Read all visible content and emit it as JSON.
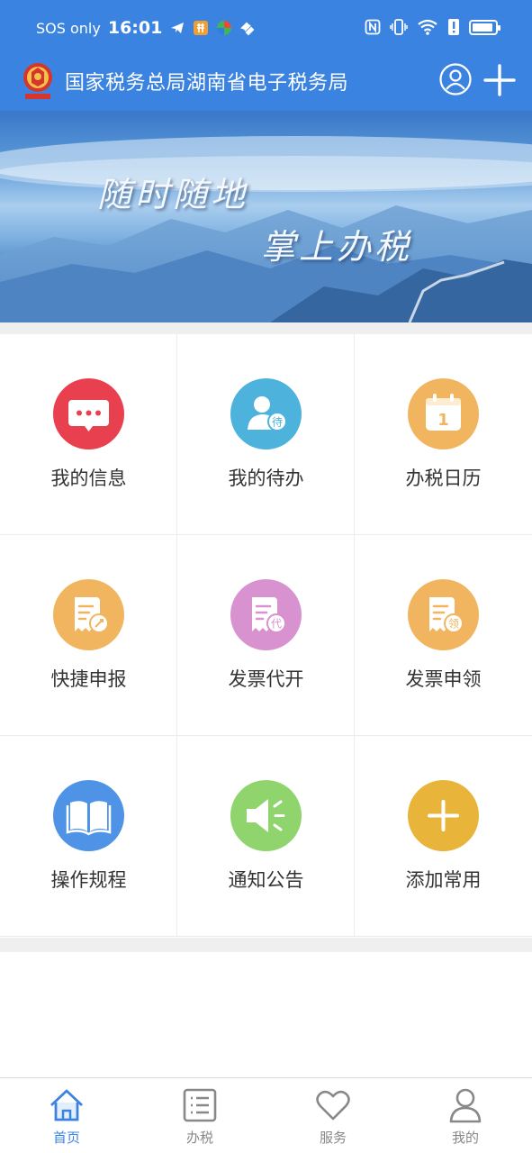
{
  "status_bar": {
    "carrier": "SOS only",
    "time": "16:01"
  },
  "header": {
    "title": "国家税务总局湖南省电子税务局"
  },
  "banner": {
    "line1": "随时随地",
    "line2": "掌上办税"
  },
  "grid": [
    {
      "label": "我的信息",
      "icon": "message-icon",
      "color": "#e8404f"
    },
    {
      "label": "我的待办",
      "icon": "todo-user-icon",
      "color": "#4db3dd"
    },
    {
      "label": "办税日历",
      "icon": "calendar-icon",
      "color": "#f2b55f",
      "badge": "1"
    },
    {
      "label": "快捷申报",
      "icon": "quick-declare-icon",
      "color": "#f2b55f"
    },
    {
      "label": "发票代开",
      "icon": "invoice-issue-icon",
      "color": "#d792cf",
      "badge": "代"
    },
    {
      "label": "发票申领",
      "icon": "invoice-apply-icon",
      "color": "#f2b55f",
      "badge": "领"
    },
    {
      "label": "操作规程",
      "icon": "book-icon",
      "color": "#4f93e6"
    },
    {
      "label": "通知公告",
      "icon": "speaker-icon",
      "color": "#8fd46c"
    },
    {
      "label": "添加常用",
      "icon": "add-icon",
      "color": "#e8b43a"
    }
  ],
  "todo_badge": "待",
  "tabs": [
    {
      "label": "首页",
      "icon": "home-icon",
      "active": true
    },
    {
      "label": "办税",
      "icon": "list-icon",
      "active": false
    },
    {
      "label": "服务",
      "icon": "heart-icon",
      "active": false
    },
    {
      "label": "我的",
      "icon": "person-icon",
      "active": false
    }
  ],
  "colors": {
    "primary": "#3b83e1",
    "tab_inactive": "#888888"
  }
}
